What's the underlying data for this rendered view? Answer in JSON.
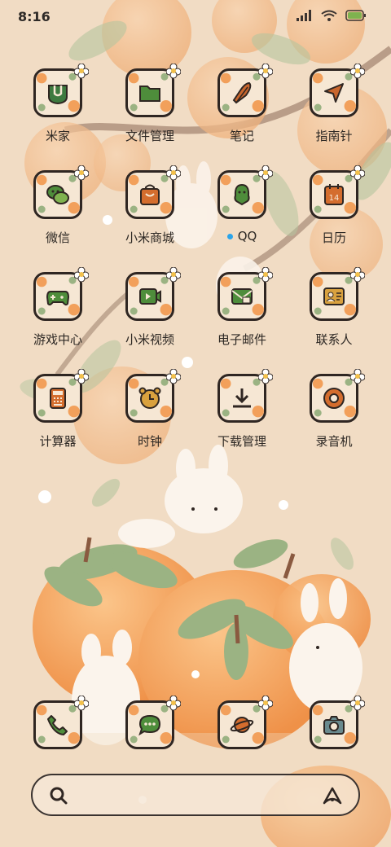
{
  "status_bar": {
    "time": "8:16",
    "icons": [
      "signal-icon",
      "wifi-icon",
      "battery-icon"
    ]
  },
  "apps": [
    {
      "label": "米家",
      "icon": "mijia-icon",
      "accent": "#3d7a3f"
    },
    {
      "label": "文件管理",
      "icon": "folder-icon",
      "accent": "#4e8d3b"
    },
    {
      "label": "笔记",
      "icon": "note-icon",
      "accent": "#c9662d"
    },
    {
      "label": "指南针",
      "icon": "compass-icon",
      "accent": "#c9662d"
    },
    {
      "label": "微信",
      "icon": "wechat-icon",
      "accent": "#4e8d3b"
    },
    {
      "label": "小米商城",
      "icon": "shop-icon",
      "accent": "#d46d2e"
    },
    {
      "label": "QQ",
      "icon": "qq-icon",
      "accent": "#4e8d3b",
      "badge_dot": "#2aa4ea"
    },
    {
      "label": "日历",
      "icon": "calendar-icon",
      "accent": "#d46d2e",
      "day": "14"
    },
    {
      "label": "游戏中心",
      "icon": "gamepad-icon",
      "accent": "#4e8d3b"
    },
    {
      "label": "小米视频",
      "icon": "video-icon",
      "accent": "#4e8d3b"
    },
    {
      "label": "电子邮件",
      "icon": "mail-icon",
      "accent": "#4e8d3b"
    },
    {
      "label": "联系人",
      "icon": "contacts-icon",
      "accent": "#d9a13e"
    },
    {
      "label": "计算器",
      "icon": "calculator-icon",
      "accent": "#d46d2e"
    },
    {
      "label": "时钟",
      "icon": "alarm-clock-icon",
      "accent": "#d9a13e"
    },
    {
      "label": "下载管理",
      "icon": "download-icon",
      "accent": "#2f2622"
    },
    {
      "label": "录音机",
      "icon": "recorder-icon",
      "accent": "#d46d2e"
    }
  ],
  "dock": [
    {
      "name": "phone",
      "icon": "phone-icon",
      "accent": "#4e8d3b"
    },
    {
      "name": "messages",
      "icon": "message-icon",
      "accent": "#4e8d3b"
    },
    {
      "name": "browser",
      "icon": "planet-icon",
      "accent": "#d46d2e"
    },
    {
      "name": "camera",
      "icon": "camera-icon",
      "accent": "#6a8a8e"
    }
  ],
  "search_bar": {
    "left_icon": "search-icon",
    "right_icon": "xiaoai-icon"
  },
  "colors": {
    "background": "#f1dcc4",
    "persimmon": "#f2a05b",
    "leaf": "#9bb383",
    "outline": "#2f2622"
  }
}
